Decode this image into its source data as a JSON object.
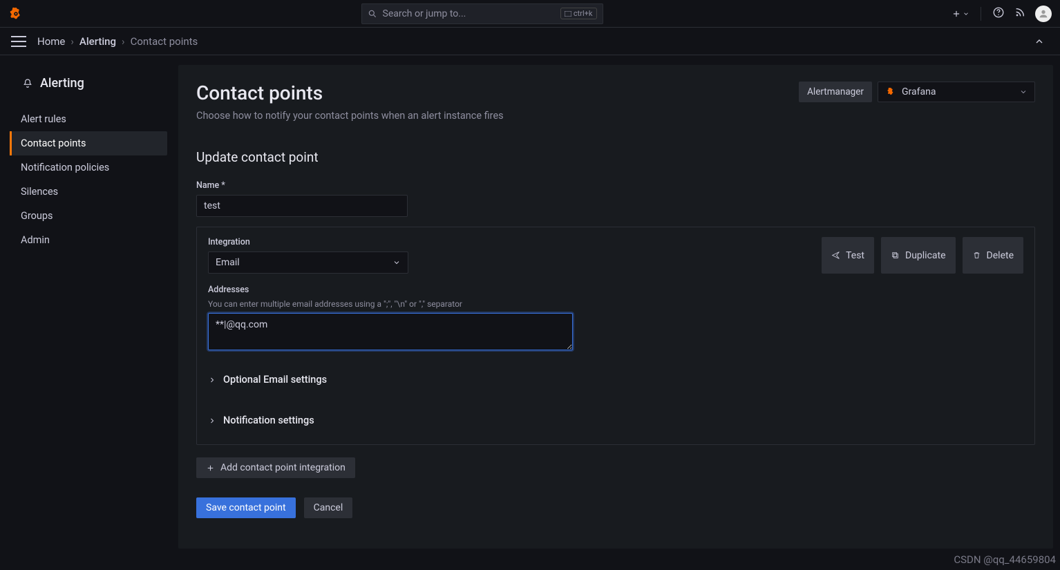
{
  "top": {
    "search_placeholder": "Search or jump to...",
    "kbd": "ctrl+k"
  },
  "breadcrumb": {
    "home": "Home",
    "alerting": "Alerting",
    "current": "Contact points"
  },
  "sidebar": {
    "heading": "Alerting",
    "items": [
      "Alert rules",
      "Contact points",
      "Notification policies",
      "Silences",
      "Groups",
      "Admin"
    ],
    "active_index": 1
  },
  "page": {
    "title": "Contact points",
    "subtitle": "Choose how to notify your contact points when an alert instance fires",
    "alertmanager_label": "Alertmanager",
    "alertmanager_value": "Grafana"
  },
  "form": {
    "section_title": "Update contact point",
    "name_label": "Name *",
    "name_value": "test",
    "integration_label": "Integration",
    "integration_value": "Email",
    "test_btn": "Test",
    "duplicate_btn": "Duplicate",
    "delete_btn": "Delete",
    "addresses_label": "Addresses",
    "addresses_hint": "You can enter multiple email addresses using a \";\", \"\\n\" or \",\" separator",
    "addresses_value": "**|@qq.com",
    "optional_label": "Optional Email settings",
    "notification_label": "Notification settings",
    "add_integration": "Add contact point integration",
    "save_btn": "Save contact point",
    "cancel_btn": "Cancel"
  },
  "watermark": "CSDN @qq_44659804"
}
